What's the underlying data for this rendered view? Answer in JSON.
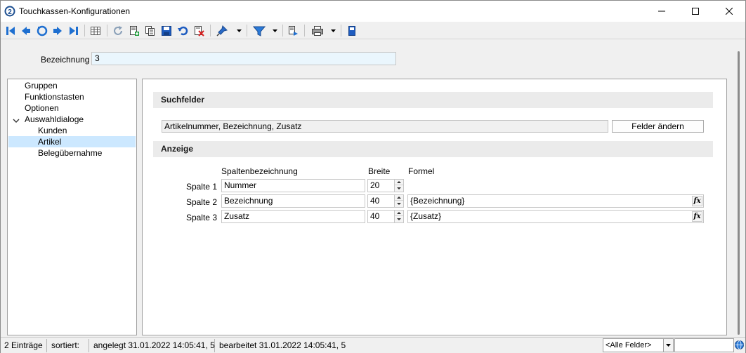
{
  "window": {
    "title": "Touchkassen-Konfigurationen"
  },
  "toolbar": {
    "icons": [
      "first-record-icon",
      "previous-record-icon",
      "refresh-circle-icon",
      "next-record-icon",
      "last-record-icon",
      "table-view-icon",
      "reload-icon",
      "new-record-icon",
      "copy-record-icon",
      "save-icon",
      "undo-icon",
      "delete-icon",
      "pin-icon",
      "filter-icon",
      "export-icon",
      "print-icon",
      "info-icon"
    ]
  },
  "header": {
    "bezeichnung_label": "Bezeichnung",
    "bezeichnung_value": "3"
  },
  "tree": {
    "items": [
      {
        "label": "Gruppen"
      },
      {
        "label": "Funktionstasten"
      },
      {
        "label": "Optionen"
      },
      {
        "label": "Auswahldialoge"
      },
      {
        "label": "Kunden"
      },
      {
        "label": "Artikel"
      },
      {
        "label": "Belegübernahme"
      }
    ]
  },
  "suchfelder": {
    "title": "Suchfelder",
    "value": "Artikelnummer, Bezeichnung, Zusatz",
    "button_label": "Felder ändern"
  },
  "anzeige": {
    "title": "Anzeige",
    "col_spaltenbezeichnung": "Spaltenbezeichnung",
    "col_breite": "Breite",
    "col_formel": "Formel",
    "rows": [
      {
        "label": "Spalte 1",
        "name": "Nummer",
        "width": "20",
        "formula": ""
      },
      {
        "label": "Spalte 2",
        "name": "Bezeichnung",
        "width": "40",
        "formula": "{Bezeichnung}"
      },
      {
        "label": "Spalte 3",
        "name": "Zusatz",
        "width": "40",
        "formula": "{Zusatz}"
      }
    ]
  },
  "status": {
    "count": "2 Einträge",
    "sorted": "sortiert:",
    "created": "angelegt 31.01.2022 14:05:41,  5",
    "edited": "bearbeitet 31.01.2022 14:05:41,  5",
    "field_filter": "<Alle Felder>"
  }
}
